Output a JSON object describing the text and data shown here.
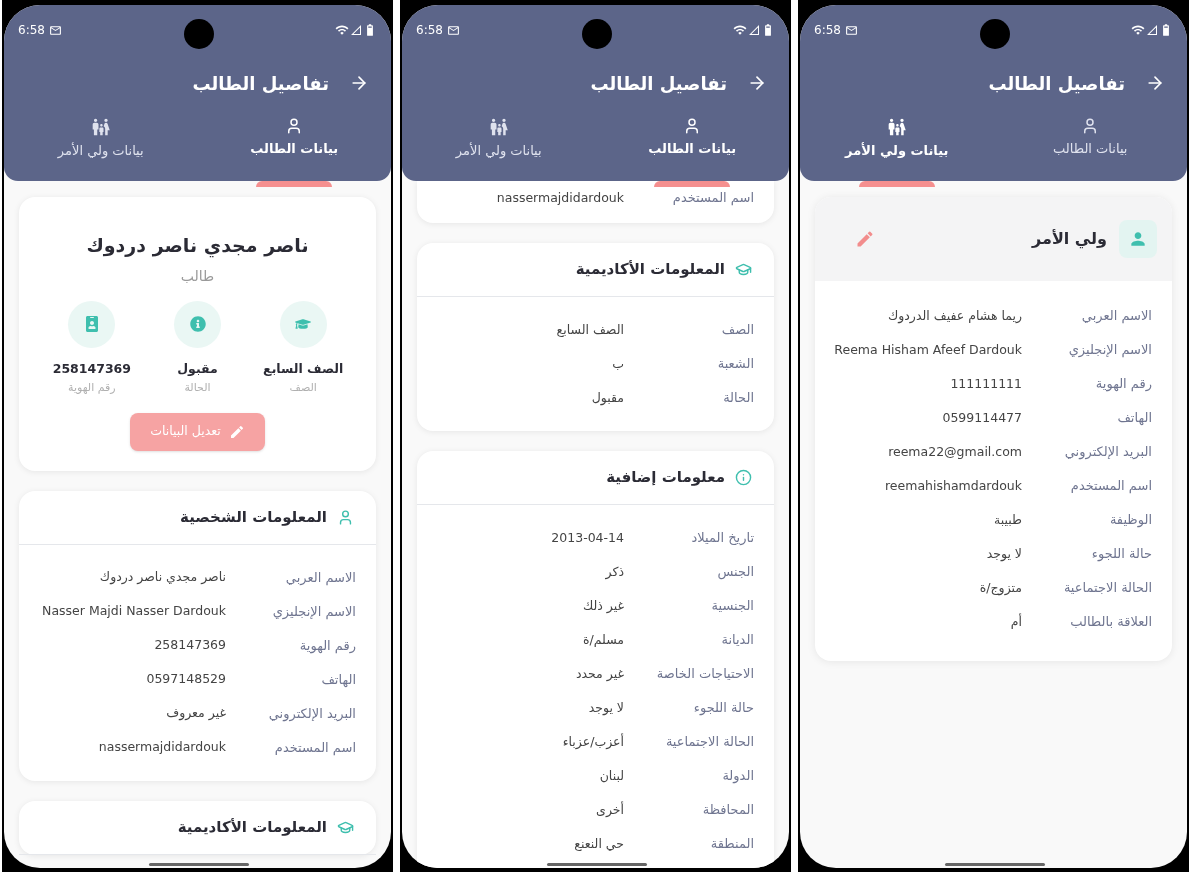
{
  "screens": [
    {
      "status_bar": {
        "time": "6:58"
      },
      "title": "تفاصيل الطالب",
      "tabs": [
        {
          "label": "بيانات الطالب",
          "kind": "student",
          "selected": false
        },
        {
          "label": "بيانات ولي الأمر",
          "kind": "guardian",
          "selected": true
        }
      ],
      "sections": [
        {
          "kind": "guardian",
          "title": "ولي الأمر",
          "rows": [
            {
              "label": "الاسم العربي",
              "value": "ريما هشام عفيف الدردوك"
            },
            {
              "label": "الاسم الإنجليزي",
              "value": "Reema Hisham Afeef Dardouk"
            },
            {
              "label": "رقم الهوية",
              "value": "111111111"
            },
            {
              "label": "الهاتف",
              "value": "0599114477"
            },
            {
              "label": "البريد الإلكتروني",
              "value": "reema22@gmail.com"
            },
            {
              "label": "اسم المستخدم",
              "value": "reemahishamdardouk"
            },
            {
              "label": "الوظيفة",
              "value": "طبيبة"
            },
            {
              "label": "حالة اللجوء",
              "value": "لا يوجد"
            },
            {
              "label": "الحالة الاجتماعية",
              "value": "متزوج/ة"
            },
            {
              "label": "العلاقة بالطالب",
              "value": "أم"
            }
          ]
        }
      ]
    },
    {
      "status_bar": {
        "time": "6:58"
      },
      "title": "تفاصيل الطالب",
      "tabs": [
        {
          "label": "بيانات الطالب",
          "kind": "student",
          "selected": true
        },
        {
          "label": "بيانات ولي الأمر",
          "kind": "guardian",
          "selected": false
        }
      ],
      "sections": [
        {
          "kind": "tail",
          "rows": [
            {
              "label": "اسم المستخدم",
              "value": "nassermajdidardouk"
            }
          ]
        },
        {
          "kind": "academic",
          "title": "المعلومات الأكاديمية",
          "rows": [
            {
              "label": "الصف",
              "value": "الصف السابع"
            },
            {
              "label": "الشعبة",
              "value": "ب"
            },
            {
              "label": "الحالة",
              "value": "مقبول"
            }
          ]
        },
        {
          "kind": "extra",
          "title": "معلومات إضافية",
          "rows": [
            {
              "label": "تاريخ الميلاد",
              "value": "2013-04-14"
            },
            {
              "label": "الجنس",
              "value": "ذكر"
            },
            {
              "label": "الجنسية",
              "value": "غير ذلك"
            },
            {
              "label": "الديانة",
              "value": "مسلم/ة"
            },
            {
              "label": "الاحتياجات الخاصة",
              "value": "غير محدد"
            },
            {
              "label": "حالة اللجوء",
              "value": "لا يوجد"
            },
            {
              "label": "الحالة الاجتماعية",
              "value": "أعزب/عزباء"
            },
            {
              "label": "الدولة",
              "value": "لبنان"
            },
            {
              "label": "المحافظة",
              "value": "أخرى"
            },
            {
              "label": "المنطقة",
              "value": "حي النعنع"
            }
          ]
        }
      ]
    },
    {
      "status_bar": {
        "time": "6:58"
      },
      "title": "تفاصيل الطالب",
      "tabs": [
        {
          "label": "بيانات الطالب",
          "kind": "student",
          "selected": true
        },
        {
          "label": "بيانات ولي الأمر",
          "kind": "guardian",
          "selected": false
        }
      ],
      "sections": [
        {
          "kind": "profile",
          "name": "ناصر مجدي ناصر دردوك",
          "role": "طالب",
          "stats": [
            {
              "kind": "grade",
              "value": "الصف السابع",
              "label": "الصف"
            },
            {
              "kind": "status",
              "value": "مقبول",
              "label": "الحالة"
            },
            {
              "kind": "id",
              "value": "258147369",
              "label": "رقم الهوية"
            }
          ],
          "button": {
            "label": "تعديل البيانات",
            "disabled": true
          }
        },
        {
          "kind": "personal",
          "title": "المعلومات الشخصية",
          "rows": [
            {
              "label": "الاسم العربي",
              "value": "ناصر مجدي ناصر دردوك"
            },
            {
              "label": "الاسم الإنجليزي",
              "value": "Nasser Majdi Nasser Dardouk"
            },
            {
              "label": "رقم الهوية",
              "value": "258147369"
            },
            {
              "label": "الهاتف",
              "value": "0597148529"
            },
            {
              "label": "البريد الإلكتروني",
              "value": "غير معروف"
            },
            {
              "label": "اسم المستخدم",
              "value": "nassermajdidardouk"
            }
          ]
        },
        {
          "kind": "academic",
          "title": "المعلومات الأكاديمية"
        }
      ]
    }
  ]
}
